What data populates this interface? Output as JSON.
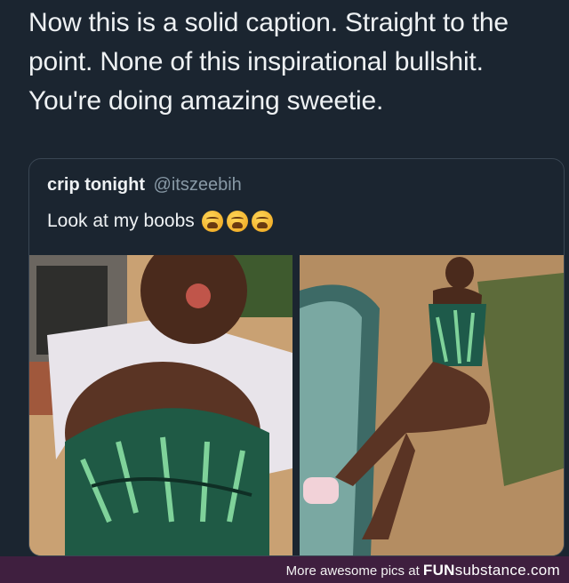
{
  "tweet": {
    "lines": [
      "Now this is a solid caption. Straight to the",
      "point. None of this inspirational bullshit.",
      "You're doing amazing sweetie."
    ]
  },
  "quoted_tweet": {
    "name": "crip tonight",
    "handle": "@itszeebih",
    "text": "Look at my boobs",
    "emojis": [
      "weary-face-icon",
      "weary-face-icon",
      "weary-face-icon"
    ]
  },
  "footer": {
    "prefix": "More awesome pics at ",
    "brand_fun": "FUN",
    "brand_rest": "substance",
    "brand_tld": ".com"
  },
  "colors": {
    "background": "#1b2530",
    "footer": "#3f1f3f",
    "handle": "#8899a6"
  }
}
